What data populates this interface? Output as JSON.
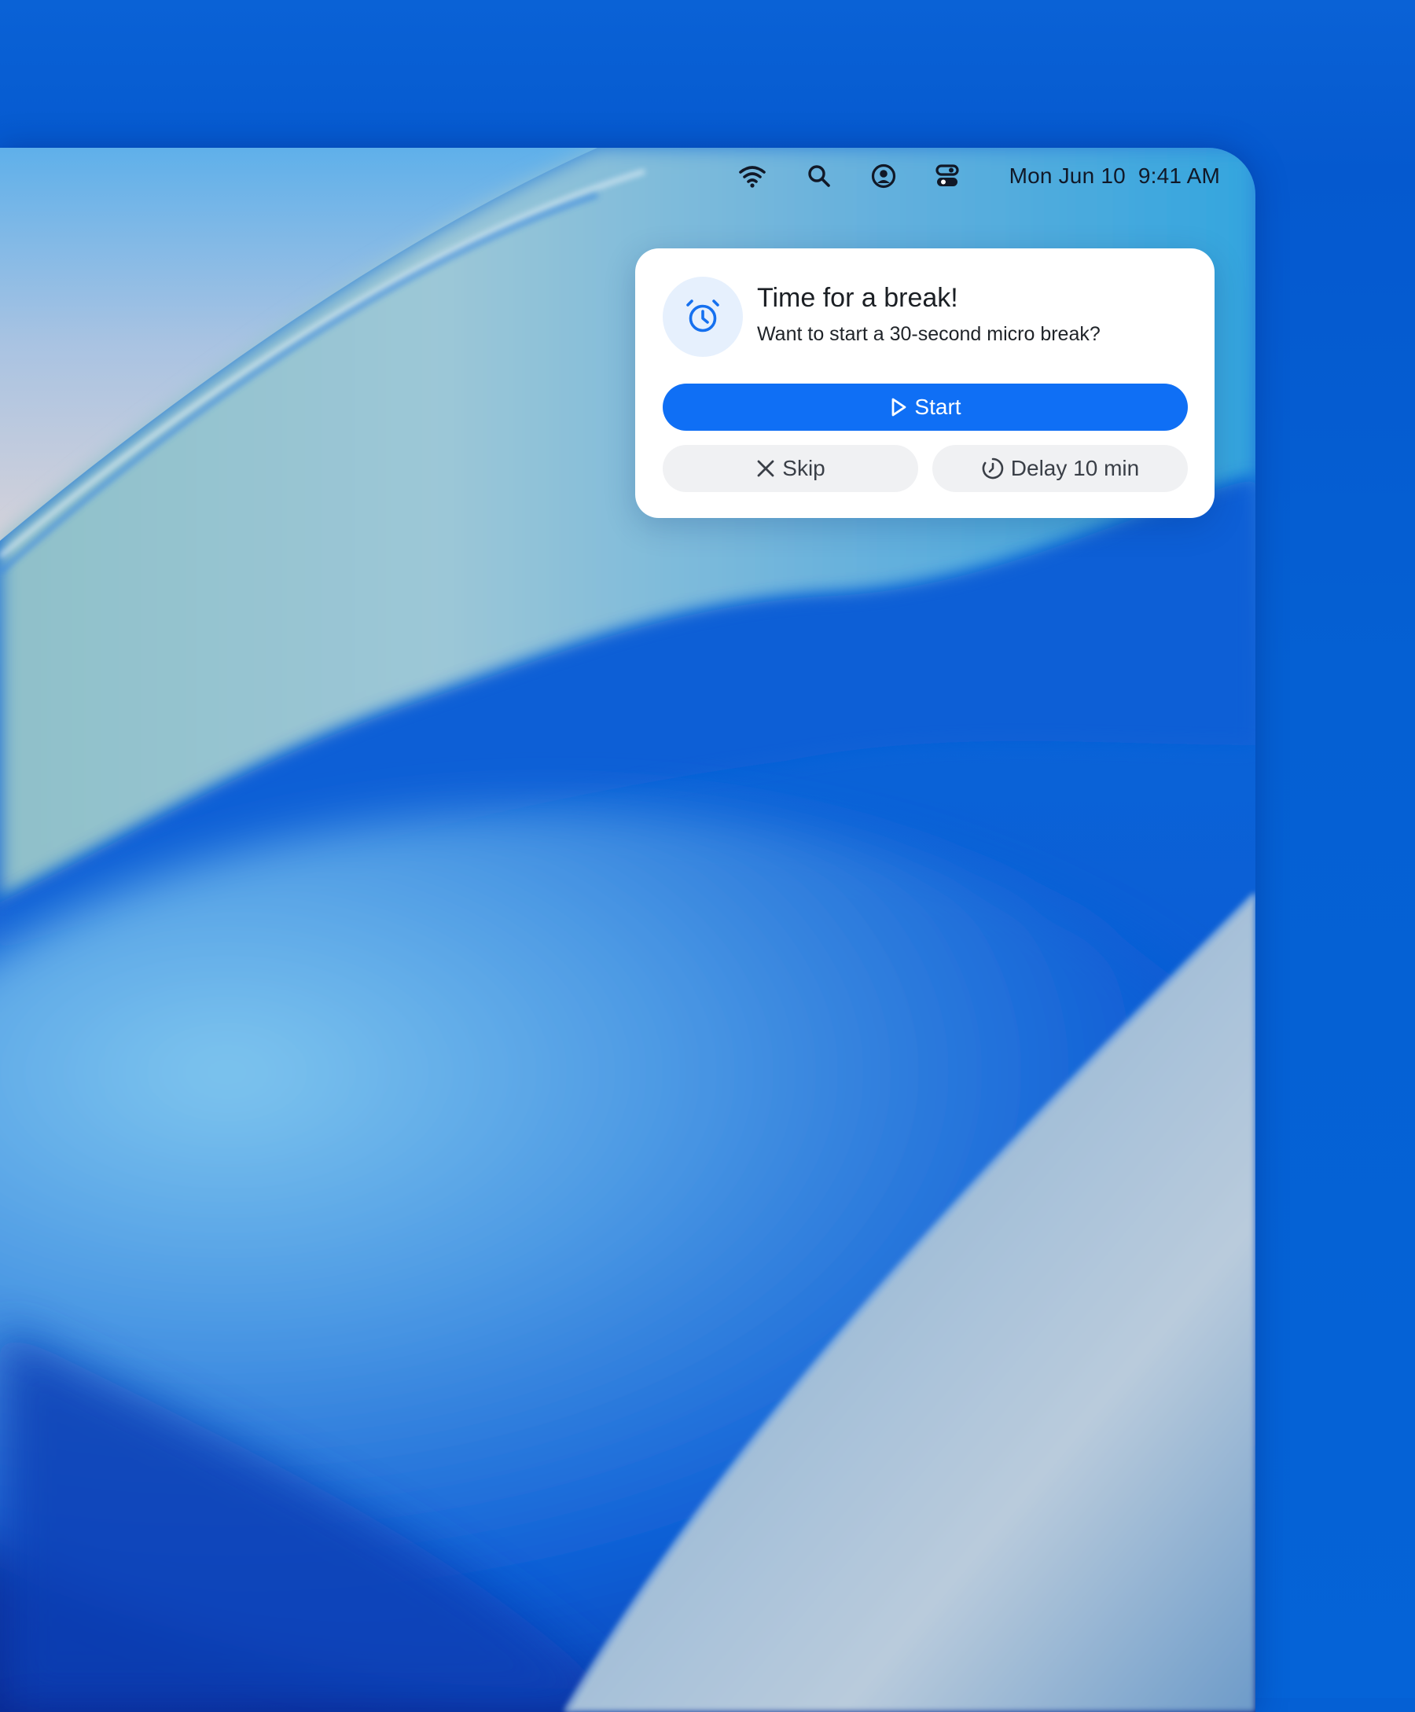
{
  "menubar": {
    "icons": [
      "wifi-icon",
      "search-icon",
      "user-account-icon",
      "control-center-icon"
    ],
    "date": "Mon Jun 10",
    "time": "9:41 AM"
  },
  "notification": {
    "icon": "alarm-clock-icon",
    "title": "Time for a break!",
    "body": "Want to start a 30-second micro break?",
    "start_label": "Start",
    "skip_label": "Skip",
    "delay_label": "Delay 10 min"
  },
  "colors": {
    "accent": "#0f6ff5",
    "icon_bg": "#e6f0fd",
    "secondary_button_bg": "#f0f1f3",
    "outer_background": "#0560d4"
  }
}
